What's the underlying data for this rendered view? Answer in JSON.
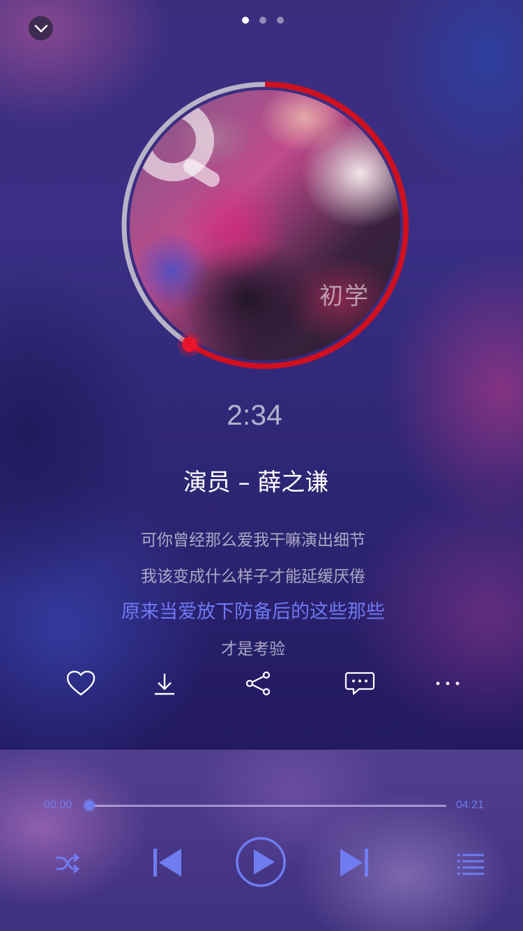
{
  "colors": {
    "accent": "#6f7df0",
    "progress_ring": "#d0101f",
    "ring_track": "#b9b3c8",
    "current_lyric": "#6f79f2"
  },
  "header": {
    "collapse_icon": "chevron-down-icon",
    "page_count": 3,
    "active_page": 1
  },
  "album": {
    "art_text": "初学",
    "logo_icon": "album-logo-icon",
    "ring_progress": 0.59
  },
  "now_playing": {
    "time": "2:34",
    "title": "演员 – 薛之谦"
  },
  "lyrics": [
    {
      "text": "可你曾经那么爱我干嘛演出细节",
      "current": false
    },
    {
      "text": "我该变成什么样子才能延缓厌倦",
      "current": false
    },
    {
      "text": "原来当爱放下防备后的这些那些",
      "current": true
    },
    {
      "text": "才是考验",
      "current": false
    }
  ],
  "actions": [
    {
      "name": "like",
      "icon": "heart-icon"
    },
    {
      "name": "download",
      "icon": "download-icon"
    },
    {
      "name": "share",
      "icon": "share-icon"
    },
    {
      "name": "comment",
      "icon": "comment-icon"
    },
    {
      "name": "more",
      "icon": "more-icon"
    }
  ],
  "player": {
    "current_time": "00:00",
    "total_time": "04:21",
    "progress": 0.0,
    "controls": [
      {
        "name": "shuffle",
        "icon": "shuffle-icon"
      },
      {
        "name": "previous",
        "icon": "previous-icon"
      },
      {
        "name": "play",
        "icon": "play-icon"
      },
      {
        "name": "next",
        "icon": "next-icon"
      },
      {
        "name": "playlist",
        "icon": "playlist-icon"
      }
    ]
  }
}
